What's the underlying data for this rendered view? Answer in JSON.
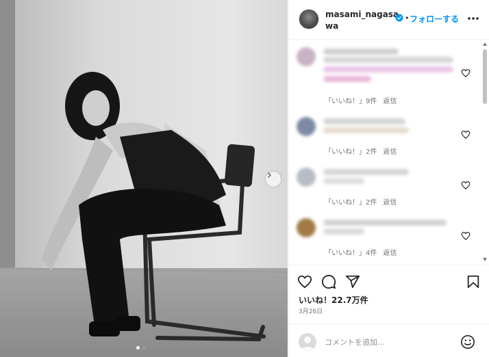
{
  "post": {
    "username": "masami_nagasawa",
    "separator": "•",
    "follow_label": "フォローする",
    "likes_text": "いいね！22.7万件",
    "date_text": "3月26日",
    "photo_count": 2,
    "current_photo": 1
  },
  "comments": [
    {
      "likes_label": "「いいね！」9件",
      "reply_label": "返信"
    },
    {
      "likes_label": "「いいね！」2件",
      "reply_label": "返信"
    },
    {
      "likes_label": "「いいね！」2件",
      "reply_label": "返信"
    },
    {
      "likes_label": "「いいね！」4件",
      "reply_label": "返信"
    }
  ],
  "add_comment": {
    "placeholder": "コメントを追加…"
  },
  "icons": {
    "verified": "verified-badge-icon",
    "more": "more-options-icon",
    "like": "heart-icon",
    "comment": "comment-bubble-icon",
    "share": "paper-plane-icon",
    "save": "bookmark-icon",
    "emoji": "smiley-icon",
    "next": "chevron-right-icon"
  },
  "colors": {
    "accent": "#0095f6",
    "text": "#262626",
    "muted": "#737373",
    "divider": "#efefef"
  }
}
